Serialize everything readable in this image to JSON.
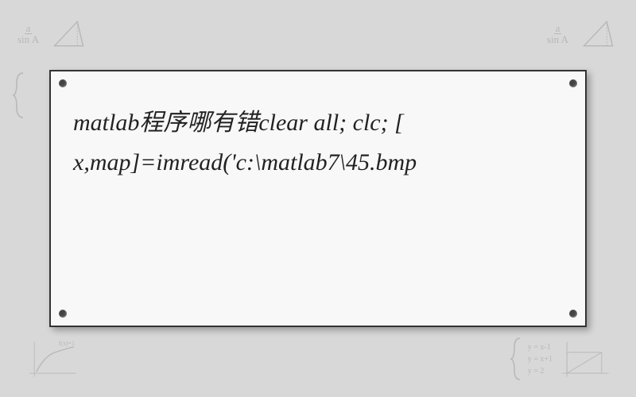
{
  "question": {
    "prompt_cn": "matlab程序哪有错",
    "code_line1": "clear all; clc; [",
    "code_line2": "x,map]=imread('c:\\matlab7\\45.bmp"
  },
  "watermarks": {
    "frac_top_left": {
      "num": "a",
      "den": "sin A"
    },
    "frac_top_right": {
      "num": "a",
      "den": "sin A"
    },
    "graph_label_bl": "f(x) = 1",
    "graph_label_br": {
      "top": "y = x-1",
      "mid": "y = x+1",
      "bot": "y = 2"
    }
  }
}
